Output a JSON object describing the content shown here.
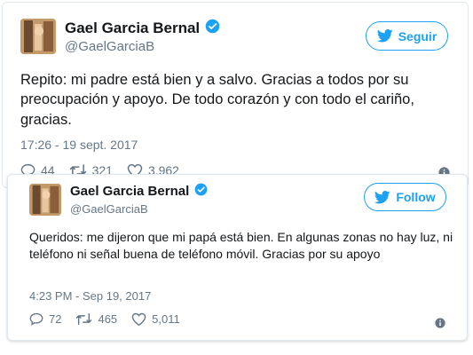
{
  "colors": {
    "accent": "#1da1f2",
    "muted": "#657786",
    "text": "#14171a"
  },
  "tweets": [
    {
      "name": "Gael Garcia Bernal",
      "handle": "@GaelGarciaB",
      "follow_label": "Seguir",
      "text": "Repito: mi padre está bien y a salvo. Gracias a todos por su preocupación y apoyo. De todo corazón y con todo el cariño, gracias.",
      "timestamp": "17:26 - 19 sept. 2017",
      "replies": "44",
      "retweets": "321",
      "likes": "3.962"
    },
    {
      "name": "Gael Garcia Bernal",
      "handle": "@GaelGarciaB",
      "follow_label": "Follow",
      "text": "Queridos: me dijeron que mi papá está bien. En algunas zonas no hay luz, ni teléfono ni señal buena de teléfono móvil. Gracias por su apoyo",
      "timestamp": "4:23 PM - Sep 19, 2017",
      "replies": "72",
      "retweets": "465",
      "likes": "5,011"
    }
  ]
}
